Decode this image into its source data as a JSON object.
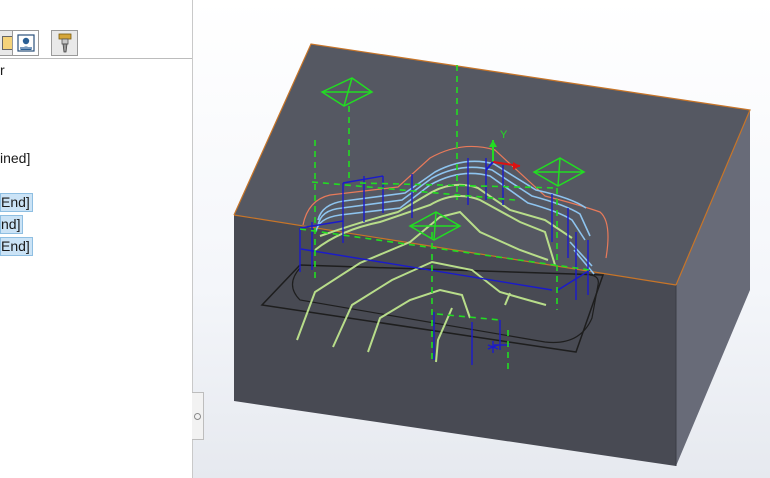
{
  "feature_tree": {
    "items": [
      {
        "text": "r",
        "selected": false
      },
      {
        "text": "ined]",
        "selected": false
      },
      {
        "text": "End]",
        "selected": true
      },
      {
        "text": "nd]",
        "selected": true
      },
      {
        "text": "End]",
        "selected": true
      }
    ]
  },
  "tabs": [
    {
      "icon": "configuration-icon",
      "active": false
    },
    {
      "icon": "operation-manager-icon",
      "active": true
    },
    {
      "icon": "tool-icon",
      "active": false
    }
  ],
  "viewport": {
    "axis_y_label": "Y",
    "colors": {
      "block_top": "#555862",
      "block_front": "#484a53",
      "block_right": "#686b78",
      "edge": "#c87528",
      "toolpath_light": "#b8dd8a",
      "toolpath_blue": "#8ec4ef",
      "link_moves": "#1a1acc",
      "rapid_moves": "#22dd22",
      "axis_x": "#dd1111"
    }
  }
}
